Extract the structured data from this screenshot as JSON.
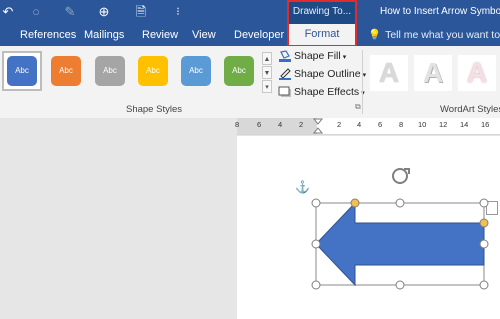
{
  "title_bar": {
    "contextual_tab_group": "Drawing To...",
    "document_title": "How to Insert Arrow Symbols"
  },
  "tabs": [
    {
      "label": "References"
    },
    {
      "label": "Mailings"
    },
    {
      "label": "Review"
    },
    {
      "label": "View"
    },
    {
      "label": "Developer"
    },
    {
      "label": "Format"
    }
  ],
  "tell_me": {
    "text": "Tell me what you want to do..."
  },
  "shape_styles": {
    "group_label": "Shape Styles",
    "swatch_label": "Abc",
    "swatch_colors": [
      "#4472c4",
      "#ed7d31",
      "#a5a5a5",
      "#ffc000",
      "#5b9bd5",
      "#70ad47"
    ],
    "commands": [
      {
        "label": "Shape Fill",
        "icon": "paint-bucket-icon"
      },
      {
        "label": "Shape Outline",
        "icon": "pen-outline-icon"
      },
      {
        "label": "Shape Effects",
        "icon": "shape-effects-icon"
      }
    ]
  },
  "wordart_styles": {
    "group_label": "WordArt Styles",
    "letter": "A"
  },
  "ruler": {
    "labels": [
      "8",
      "6",
      "4",
      "2",
      "2",
      "4",
      "6",
      "8",
      "10",
      "12",
      "14",
      "16"
    ]
  },
  "shape": {
    "type": "left-arrow",
    "fill": "#4472c4",
    "outline": "#2f528f"
  }
}
